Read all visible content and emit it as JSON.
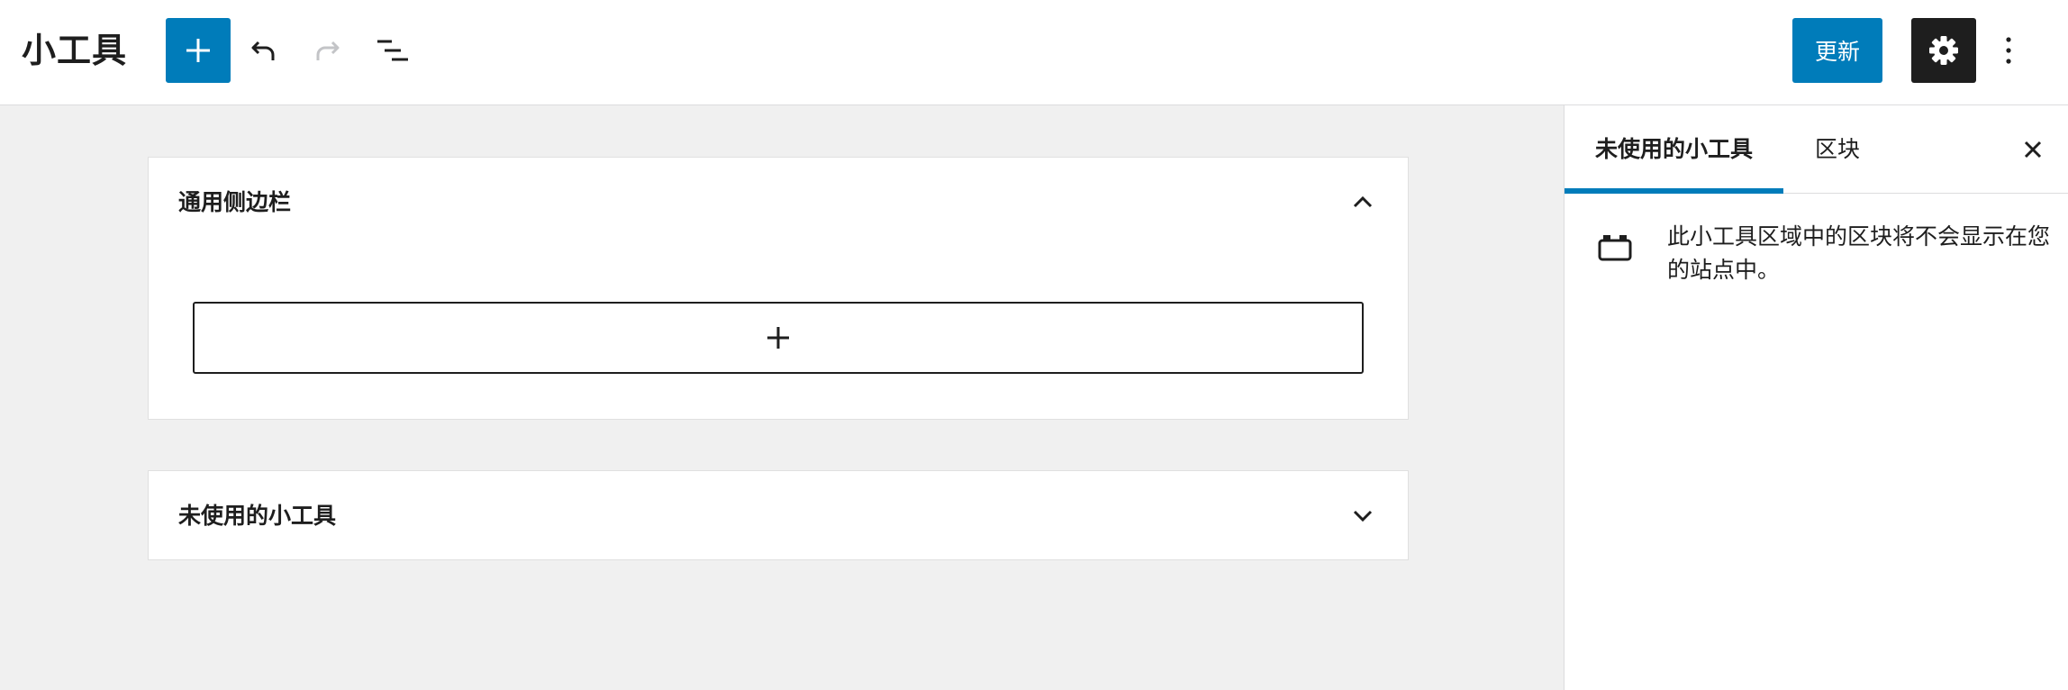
{
  "header": {
    "title": "小工具",
    "update_label": "更新",
    "icons": {
      "add": "plus-icon",
      "undo": "undo-icon",
      "redo": "redo-icon",
      "list": "list-view-icon",
      "settings": "gear-icon",
      "more": "more-vertical-icon"
    }
  },
  "canvas": {
    "areas": [
      {
        "title": "通用侧边栏",
        "expanded": true
      },
      {
        "title": "未使用的小工具",
        "expanded": false
      }
    ]
  },
  "sidebar": {
    "tabs": [
      {
        "label": "未使用的小工具",
        "active": true
      },
      {
        "label": "区块",
        "active": false
      }
    ],
    "info_text": "此小工具区域中的区块将不会显示在您的站点中。"
  },
  "colors": {
    "accent": "#007cba",
    "dark": "#1e1e1e",
    "canvas_bg": "#f0f0f0",
    "disabled": "#c3c4c7"
  }
}
